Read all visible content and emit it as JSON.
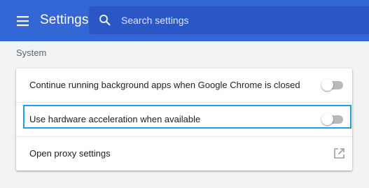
{
  "header": {
    "title": "Settings",
    "menu_icon": "hamburger-menu-icon",
    "search": {
      "placeholder": "Search settings",
      "value": "",
      "icon": "search-icon"
    }
  },
  "section": {
    "title": "System",
    "items": [
      {
        "label": "Continue running background apps when Google Chrome is closed",
        "control": "toggle",
        "checked": false
      },
      {
        "label": "Use hardware acceleration when available",
        "control": "toggle",
        "checked": false,
        "highlighted": true
      },
      {
        "label": "Open proxy settings",
        "control": "launch-icon"
      }
    ]
  },
  "colors": {
    "header_bg": "#3367d6",
    "search_bg": "#2a56c6",
    "page_bg": "#f1f3f4",
    "highlight_border": "#1ba1e2",
    "toggle_off_track": "#b9b9b9"
  }
}
